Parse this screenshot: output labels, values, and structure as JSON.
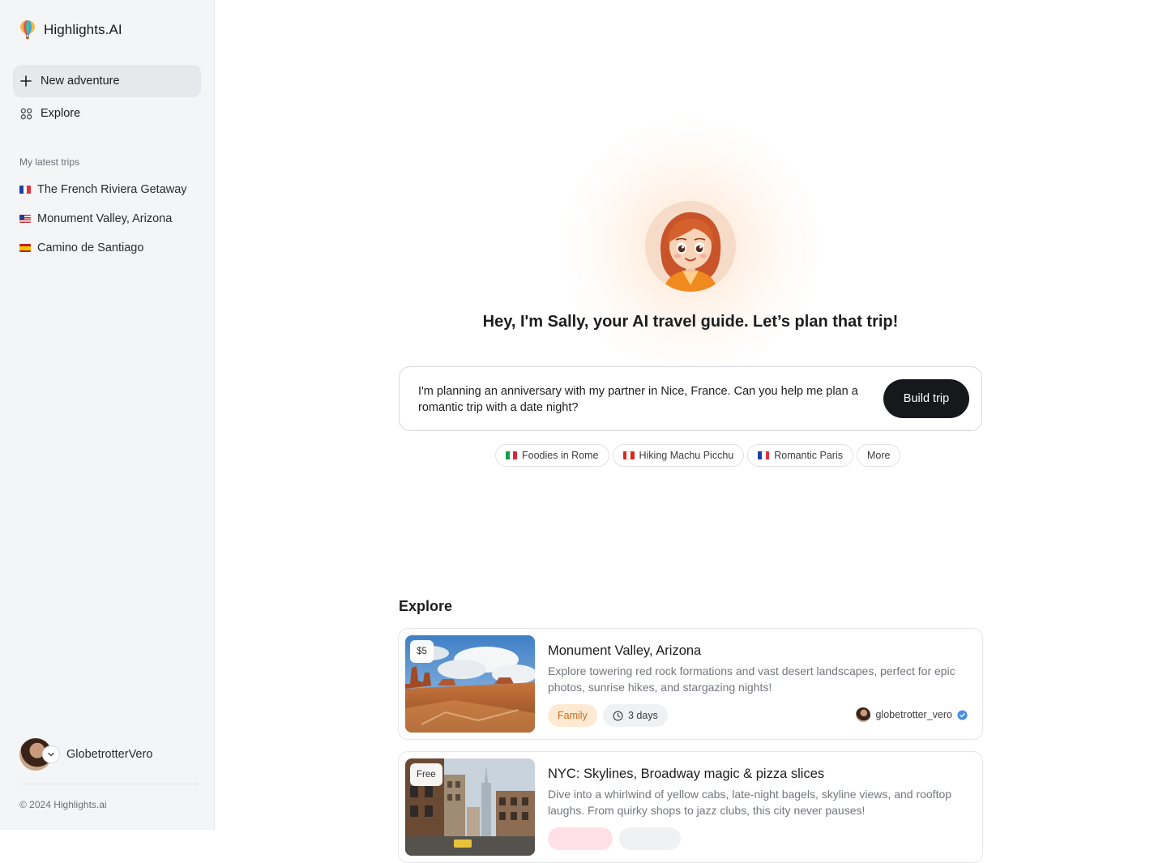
{
  "brand": {
    "name": "Highlights.AI"
  },
  "nav": {
    "new_adventure": "New adventure",
    "explore": "Explore"
  },
  "sidebar": {
    "section_label": "My latest trips",
    "trips": [
      {
        "label": "The French Riviera Getaway",
        "flag": "france"
      },
      {
        "label": "Monument Valley, Arizona",
        "flag": "usa"
      },
      {
        "label": "Camino de Santiago",
        "flag": "spain"
      }
    ],
    "user_name": "GlobetrotterVero",
    "copyright": "© 2024 Highlights.ai"
  },
  "hero": {
    "title": "Hey, I'm Sally, your AI travel guide. Let’s plan that trip!"
  },
  "prompt": {
    "text": "I'm planning an anniversary with my partner in Nice, France. Can you help me plan a romantic trip with a date night?",
    "button": "Build trip"
  },
  "suggestions": [
    {
      "label": "Foodies in Rome",
      "flag": "italy"
    },
    {
      "label": "Hiking Machu Picchu",
      "flag": "peru"
    },
    {
      "label": "Romantic Paris",
      "flag": "france"
    },
    {
      "label": "More",
      "flag": ""
    }
  ],
  "explore": {
    "title": "Explore",
    "cards": [
      {
        "price": "$5",
        "title": "Monument Valley, Arizona",
        "description": "Explore towering red rock formations and vast desert landscapes, perfect for epic photos, sunrise hikes, and stargazing nights!",
        "tag": "Family",
        "duration": "3 days",
        "author": "globetrotter_vero"
      },
      {
        "price": "Free",
        "title": "NYC: Skylines, Broadway magic & pizza slices",
        "description": "Dive into a whirlwind of yellow cabs, late-night bagels, skyline views, and rooftop laughs. From quirky shops to jazz clubs, this city never pauses!"
      }
    ]
  },
  "colors": {
    "sidebar_bg": "#f4f5f7",
    "button_dark": "#16181b",
    "family_tag_bg": "#ffe9d3",
    "family_tag_text": "#c96a1b",
    "verified": "#4a90e2"
  }
}
